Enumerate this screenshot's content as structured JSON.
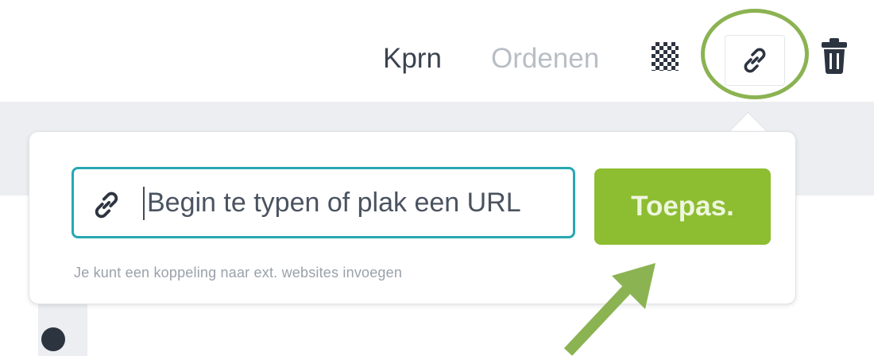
{
  "toolbar": {
    "kprn_label": "Kprn",
    "ordenen_label": "Ordenen",
    "transparency_icon": "checkerboard-icon",
    "link_icon": "link-icon",
    "trash_icon": "trash-icon"
  },
  "link_popover": {
    "input_placeholder": "Begin te typen of plak een URL",
    "input_value": "",
    "apply_label": "Toepas.",
    "hint_text": "Je kunt een koppeling naar ext. websites invoegen"
  },
  "colors": {
    "accent_green": "#8dbd30",
    "input_border": "#27a8b3",
    "annotation_green": "#8bb352"
  }
}
